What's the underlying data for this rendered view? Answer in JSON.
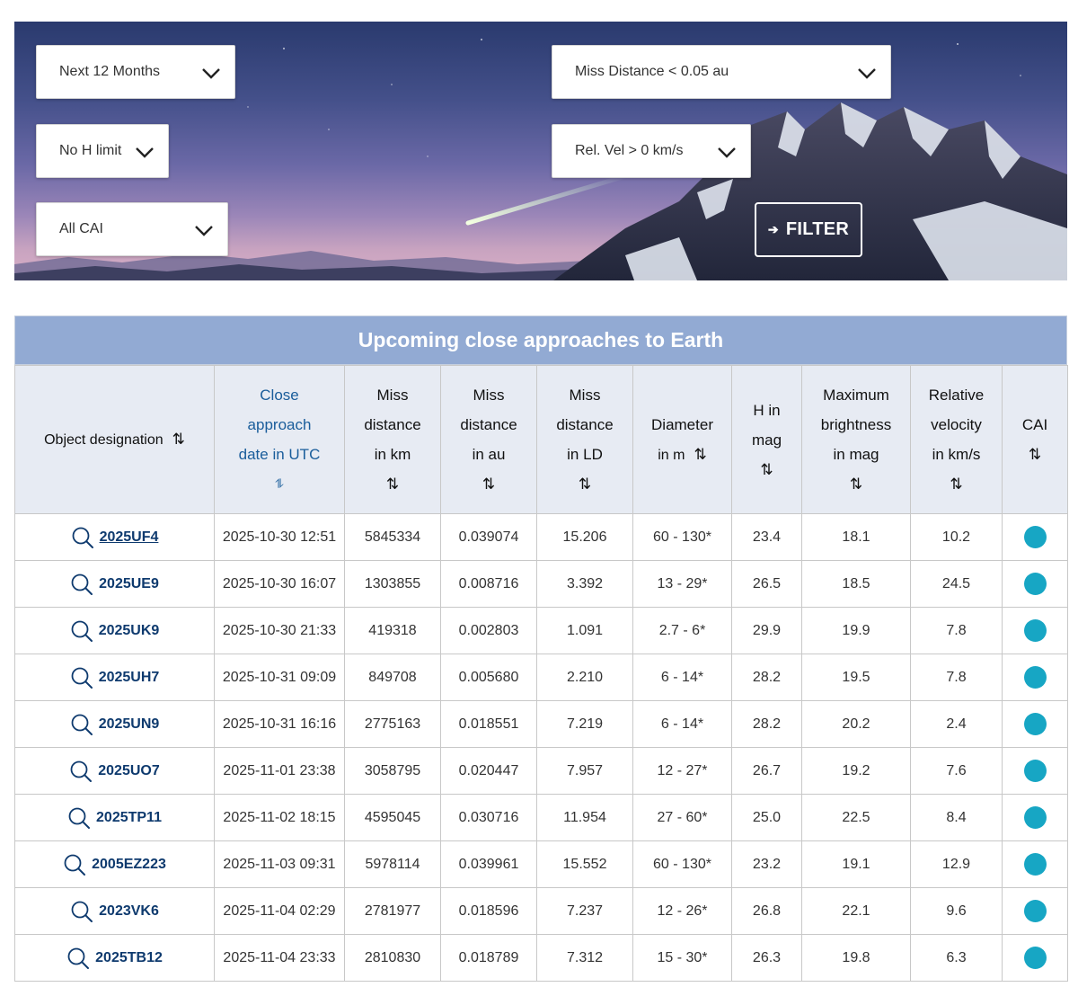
{
  "filters": {
    "period": "Next 12 Months",
    "miss_distance": "Miss Distance < 0.05 au",
    "h_limit": "No H limit",
    "rel_vel": "Rel. Vel > 0 km/s",
    "cai": "All CAI",
    "filter_button": "FILTER"
  },
  "table": {
    "title": "Upcoming close approaches to Earth",
    "headers": {
      "object": "Object designation",
      "date": [
        "Close",
        "approach",
        "date in UTC"
      ],
      "km": [
        "Miss",
        "distance",
        "in km"
      ],
      "au": [
        "Miss",
        "distance",
        "in au"
      ],
      "ld": [
        "Miss",
        "distance",
        "in LD"
      ],
      "diam": [
        "Diameter",
        "in m"
      ],
      "h": [
        "H in",
        "mag"
      ],
      "bright": [
        "Maximum",
        "brightness",
        "in mag"
      ],
      "vel": [
        "Relative",
        "velocity",
        "in km/s"
      ],
      "cai": "CAI"
    },
    "sort_icon": "⇅",
    "sort_active_icon": "⥮",
    "cai_color": "#17a6c4",
    "rows": [
      {
        "name": "2025UF4",
        "date": "2025-10-30 12:51",
        "km": "5845334",
        "au": "0.039074",
        "ld": "15.206",
        "diam": "60 - 130*",
        "h": "23.4",
        "bright": "18.1",
        "vel": "10.2"
      },
      {
        "name": "2025UE9",
        "date": "2025-10-30 16:07",
        "km": "1303855",
        "au": "0.008716",
        "ld": "3.392",
        "diam": "13 - 29*",
        "h": "26.5",
        "bright": "18.5",
        "vel": "24.5"
      },
      {
        "name": "2025UK9",
        "date": "2025-10-30 21:33",
        "km": "419318",
        "au": "0.002803",
        "ld": "1.091",
        "diam": "2.7 - 6*",
        "h": "29.9",
        "bright": "19.9",
        "vel": "7.8"
      },
      {
        "name": "2025UH7",
        "date": "2025-10-31 09:09",
        "km": "849708",
        "au": "0.005680",
        "ld": "2.210",
        "diam": "6 - 14*",
        "h": "28.2",
        "bright": "19.5",
        "vel": "7.8"
      },
      {
        "name": "2025UN9",
        "date": "2025-10-31 16:16",
        "km": "2775163",
        "au": "0.018551",
        "ld": "7.219",
        "diam": "6 - 14*",
        "h": "28.2",
        "bright": "20.2",
        "vel": "2.4"
      },
      {
        "name": "2025UO7",
        "date": "2025-11-01 23:38",
        "km": "3058795",
        "au": "0.020447",
        "ld": "7.957",
        "diam": "12 - 27*",
        "h": "26.7",
        "bright": "19.2",
        "vel": "7.6"
      },
      {
        "name": "2025TP11",
        "date": "2025-11-02 18:15",
        "km": "4595045",
        "au": "0.030716",
        "ld": "11.954",
        "diam": "27 - 60*",
        "h": "25.0",
        "bright": "22.5",
        "vel": "8.4"
      },
      {
        "name": "2005EZ223",
        "date": "2025-11-03 09:31",
        "km": "5978114",
        "au": "0.039961",
        "ld": "15.552",
        "diam": "60 - 130*",
        "h": "23.2",
        "bright": "19.1",
        "vel": "12.9"
      },
      {
        "name": "2023VK6",
        "date": "2025-11-04 02:29",
        "km": "2781977",
        "au": "0.018596",
        "ld": "7.237",
        "diam": "12 - 26*",
        "h": "26.8",
        "bright": "22.1",
        "vel": "9.6"
      },
      {
        "name": "2025TB12",
        "date": "2025-11-04 23:33",
        "km": "2810830",
        "au": "0.018789",
        "ld": "7.312",
        "diam": "15 - 30*",
        "h": "26.3",
        "bright": "19.8",
        "vel": "6.3"
      }
    ]
  }
}
